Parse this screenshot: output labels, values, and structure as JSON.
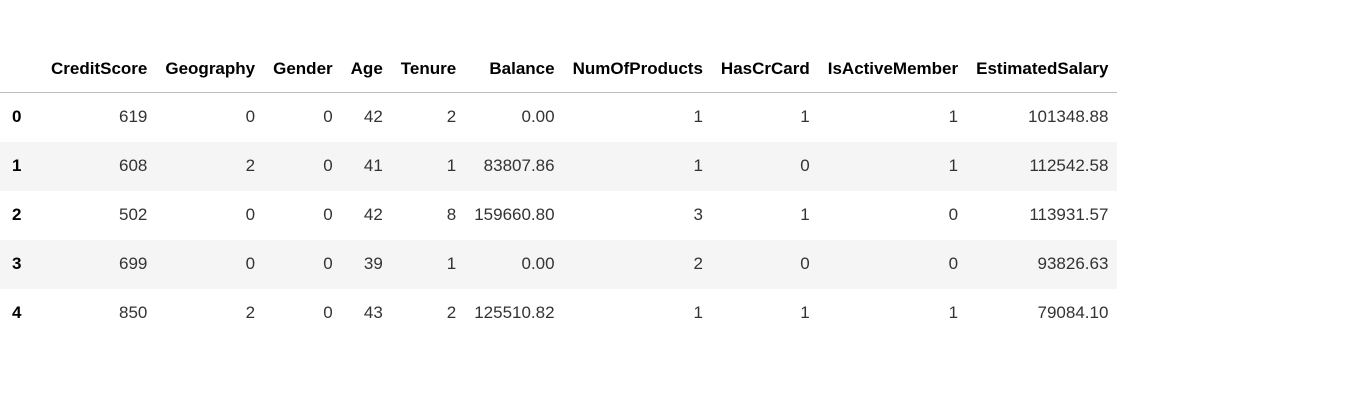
{
  "table": {
    "index_header": "",
    "columns": [
      "CreditScore",
      "Geography",
      "Gender",
      "Age",
      "Tenure",
      "Balance",
      "NumOfProducts",
      "HasCrCard",
      "IsActiveMember",
      "EstimatedSalary"
    ],
    "rows": [
      {
        "index": "0",
        "cells": [
          "619",
          "0",
          "0",
          "42",
          "2",
          "0.00",
          "1",
          "1",
          "1",
          "101348.88"
        ]
      },
      {
        "index": "1",
        "cells": [
          "608",
          "2",
          "0",
          "41",
          "1",
          "83807.86",
          "1",
          "0",
          "1",
          "112542.58"
        ]
      },
      {
        "index": "2",
        "cells": [
          "502",
          "0",
          "0",
          "42",
          "8",
          "159660.80",
          "3",
          "1",
          "0",
          "113931.57"
        ]
      },
      {
        "index": "3",
        "cells": [
          "699",
          "0",
          "0",
          "39",
          "1",
          "0.00",
          "2",
          "0",
          "0",
          "93826.63"
        ]
      },
      {
        "index": "4",
        "cells": [
          "850",
          "2",
          "0",
          "43",
          "2",
          "125510.82",
          "1",
          "1",
          "1",
          "79084.10"
        ]
      }
    ]
  }
}
